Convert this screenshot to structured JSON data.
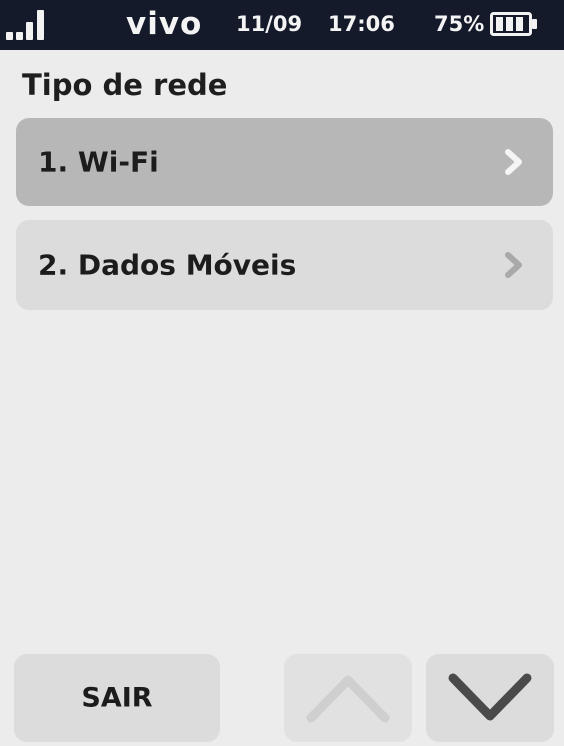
{
  "status_bar": {
    "signal_icon": "signal-strength-icon",
    "carrier": "vivo",
    "date": "11/09",
    "time": "17:06",
    "battery_percent": "75%",
    "battery_icon": "battery-icon",
    "battery_level": 0.75
  },
  "title": "Tipo de rede",
  "menu": {
    "items": [
      {
        "label": "1. Wi-Fi",
        "icon": "chevron-right-icon",
        "selected": true
      },
      {
        "label": "2. Dados Móveis",
        "icon": "chevron-right-icon",
        "selected": false
      }
    ]
  },
  "softkeys": {
    "exit_label": "SAIR",
    "up_icon": "arrow-up-icon",
    "down_icon": "arrow-down-icon"
  },
  "colors": {
    "status_bar_bg": "#141a2a",
    "background": "#ececec",
    "item_bg": "#dcdcdc",
    "item_selected_bg": "#b7b7b7"
  }
}
